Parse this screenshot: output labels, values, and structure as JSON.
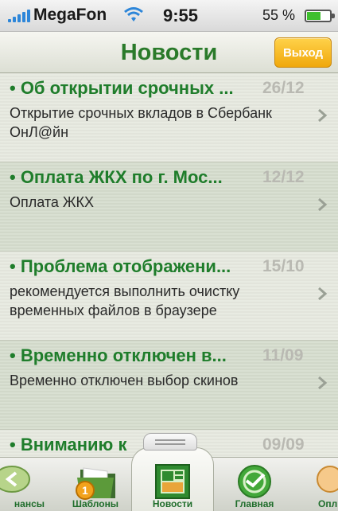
{
  "status_bar": {
    "carrier": "MegaFon",
    "time": "9:55",
    "battery": "55 %"
  },
  "nav": {
    "title": "Новости",
    "exit_label": "Выход"
  },
  "news": [
    {
      "title": "• Об открытии срочных ...",
      "date": "26/12",
      "body": "Открытие срочных вкладов в Сбербанк ОнЛ@йн"
    },
    {
      "title": "• Оплата ЖКХ по г. Мос...",
      "date": "12/12",
      "body": "Оплата ЖКХ"
    },
    {
      "title": "• Проблема отображени...",
      "date": "15/10",
      "body": "рекомендуется выполнить очистку временных файлов в браузере"
    },
    {
      "title": "• Временно отключен в...",
      "date": "11/09",
      "body": "Временно отключен выбор скинов"
    },
    {
      "title": "• Вниманию к",
      "date": "09/09",
      "body": ""
    }
  ],
  "tabs": [
    {
      "label": "нансы",
      "icon": "coins-icon"
    },
    {
      "label": "Шаблоны",
      "icon": "folder-icon"
    },
    {
      "label": "Новости",
      "icon": "news-icon"
    },
    {
      "label": "Главная",
      "icon": "sberbank-logo-icon"
    },
    {
      "label": "Опл",
      "icon": "payments-icon"
    }
  ]
}
